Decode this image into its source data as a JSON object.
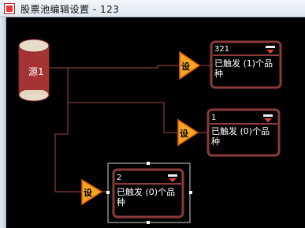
{
  "window": {
    "title": "股票池编辑设置 - 123"
  },
  "source": {
    "label": "源1"
  },
  "triggers": [
    {
      "label": "设"
    },
    {
      "label": "设"
    },
    {
      "label": "设"
    }
  ],
  "nodes": [
    {
      "value": "321",
      "status": "已触发 (1)个品种"
    },
    {
      "value": "1",
      "status": "已触发 (0)个品种"
    },
    {
      "value": "2",
      "status": "已触发 (0)个品种"
    }
  ],
  "colors": {
    "node_border": "#8b3a3a",
    "trigger_fill": "#f5a623",
    "trigger_border": "#e05a00",
    "connector": "#9a4a4a",
    "selection": "#cfcfcf",
    "cylinder_body": "#a63333",
    "cylinder_top": "#e8dcc8"
  },
  "icons": {
    "dropdown": "chevron-down-icon",
    "app": "app-icon"
  }
}
